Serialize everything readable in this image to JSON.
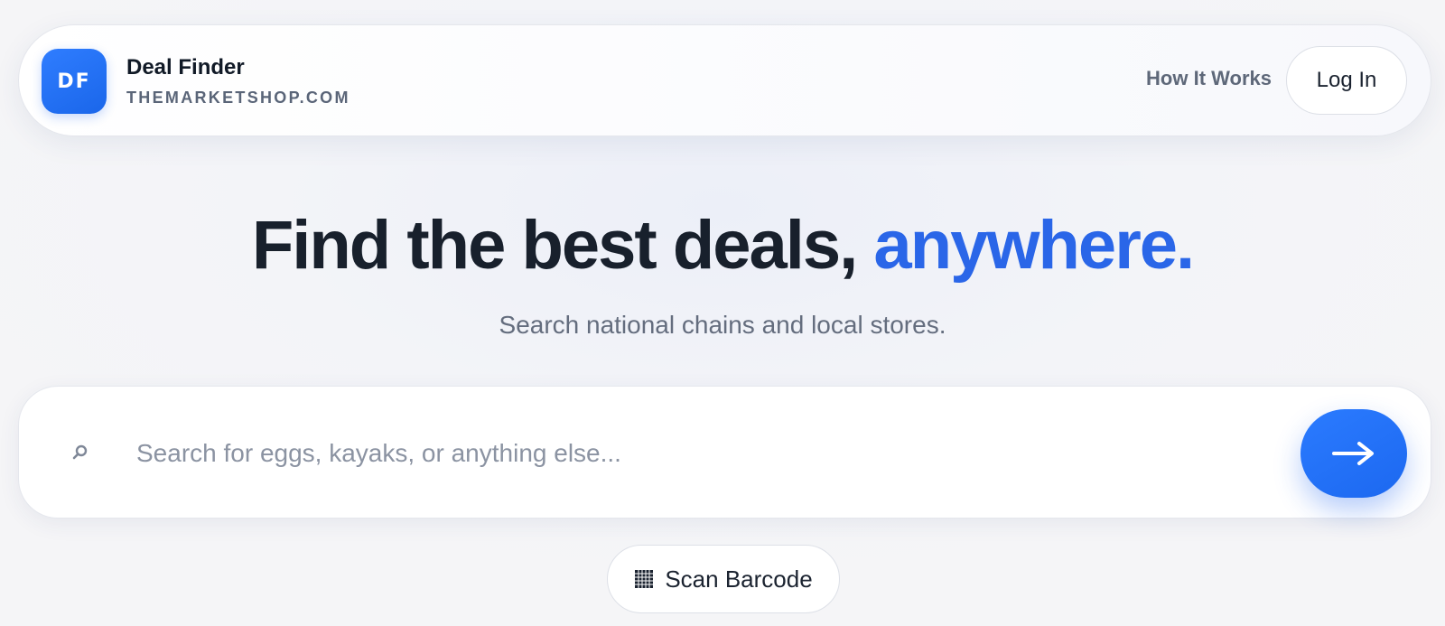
{
  "header": {
    "logo_text": "DF",
    "brand_name": "Deal Finder",
    "brand_domain": "THEMARKETSHOP.COM",
    "nav_link": "How It Works",
    "login_label": "Log In"
  },
  "hero": {
    "title_main": "Find the best deals, ",
    "title_accent": "anywhere.",
    "subtitle": "Search national chains and local stores."
  },
  "search": {
    "placeholder": "Search for eggs, kayaks, or anything else...",
    "value": "",
    "icon": "search-icon",
    "submit_icon": "arrow-right-icon"
  },
  "scan": {
    "label": "Scan Barcode",
    "icon": "barcode-icon"
  },
  "colors": {
    "accent": "#2a66e8",
    "button_blue": "#1c68f0",
    "text_dark": "#18202c",
    "text_muted": "#646d7e"
  }
}
